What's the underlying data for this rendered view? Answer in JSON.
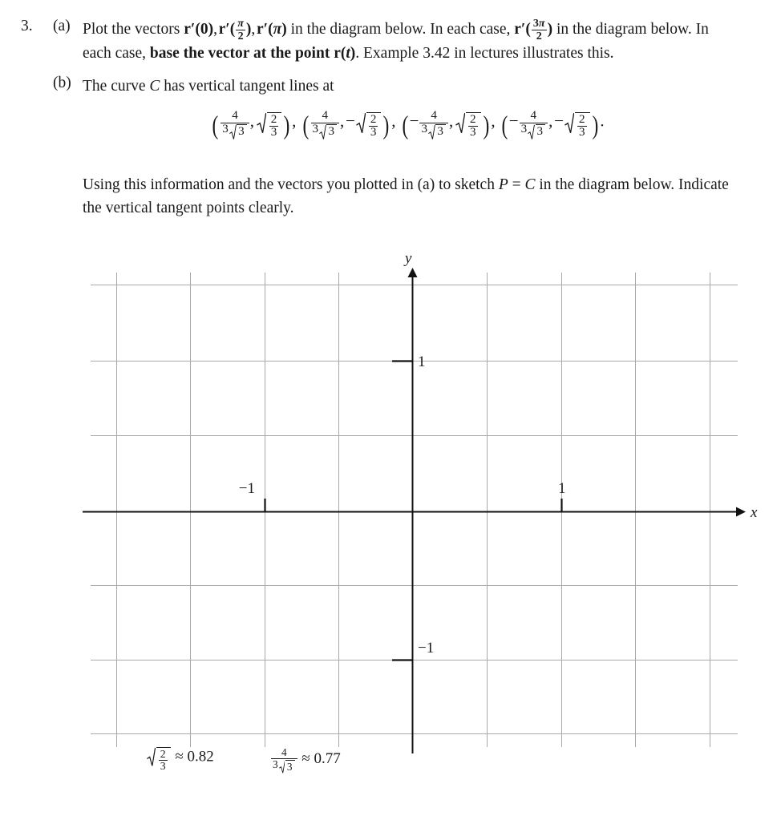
{
  "question": {
    "number": "3.",
    "parts": [
      {
        "label": "(a)",
        "text_lead": "Plot the vectors ",
        "vectors": [
          "r′(0)",
          "r′(π/2)",
          "r′(π)",
          "r′(3π/2)"
        ],
        "text_mid": " in the diagram below. In each case, ",
        "text_bold": "base the vector at the point r(t)",
        "text_tail": ". Example 3.42 in lectures illustrates this."
      },
      {
        "label": "(b)",
        "text_lead": "The curve C has vertical tangent lines at",
        "points": [
          {
            "x": "4/(3√3)",
            "y": "√(2/3)"
          },
          {
            "x": "4/(3√3)",
            "y": "−√(2/3)"
          },
          {
            "x": "−4/(3√3)",
            "y": "√(2/3)"
          },
          {
            "x": "−4/(3√3)",
            "y": "−√(2/3)"
          }
        ],
        "text_tail": "Using this information and the vectors you plotted in (a) to sketch P = C in the diagram below. Indicate the vertical tangent points clearly."
      }
    ]
  },
  "numerals": {
    "two": "2",
    "three": "3",
    "four": "4",
    "three_b": "3",
    "three_c": "3",
    "three_d": "3"
  },
  "curve_symbol": "C",
  "p_symbol": "P",
  "t_symbol": "t",
  "chart_data": {
    "type": "scatter",
    "title": "",
    "xlabel": "x",
    "ylabel": "y",
    "grid": true,
    "legend": "none",
    "xlim": [
      -4.35,
      4.65
    ],
    "ylim": [
      -3.05,
      3.05
    ],
    "xticks": [
      -1,
      1
    ],
    "yticks": [
      -1,
      1
    ],
    "xtick_labels": [
      "−1",
      "1"
    ],
    "ytick_labels": [
      "−1",
      "1"
    ],
    "gridline_step": 1,
    "series": [],
    "annotations": [],
    "note": "Empty labelled Cartesian grid for student sketching; no curve drawn."
  },
  "graph": {
    "x_axis_label": "x",
    "y_axis_label": "y",
    "x_tick_pos_label": "1",
    "x_tick_neg_label": "−1",
    "y_tick_pos_label": "1",
    "y_tick_neg_label": "−1"
  },
  "footnotes": [
    {
      "expr_num": "2",
      "expr_den": "3",
      "approx": "≈ 0.82",
      "value": "0.82"
    },
    {
      "expr_num": "4",
      "expr_den_a": "3",
      "expr_den_b": "3",
      "approx": "≈ 0.77",
      "value": "0.77"
    }
  ],
  "symbols": {
    "approx": "≈",
    "minus": "−",
    "comma": ",",
    "period": ".",
    "pi": "π",
    "prime": "′",
    "equals": "="
  }
}
